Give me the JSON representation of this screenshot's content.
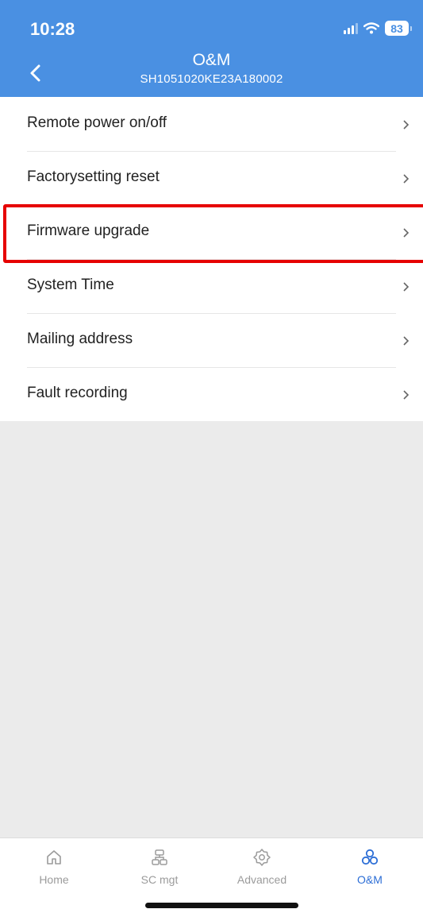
{
  "status_bar": {
    "time": "10:28",
    "battery": "83"
  },
  "header": {
    "title": "O&M",
    "subtitle": "SH1051020KE23A180002"
  },
  "menu": {
    "items": [
      {
        "label": "Remote power on/off"
      },
      {
        "label": "Factorysetting reset"
      },
      {
        "label": "Firmware upgrade",
        "highlighted": true
      },
      {
        "label": "System Time"
      },
      {
        "label": "Mailing address"
      },
      {
        "label": "Fault recording"
      }
    ]
  },
  "tabbar": {
    "tabs": [
      {
        "label": "Home",
        "icon": "home-icon"
      },
      {
        "label": "SC mgt",
        "icon": "sc-mgt-icon"
      },
      {
        "label": "Advanced",
        "icon": "gear-icon"
      },
      {
        "label": "O&M",
        "icon": "om-icon",
        "active": true
      }
    ]
  },
  "colors": {
    "header_bg": "#4a90e2",
    "active_tab": "#2c6ed6",
    "highlight_box": "#e60000",
    "page_bg": "#ebebeb"
  }
}
